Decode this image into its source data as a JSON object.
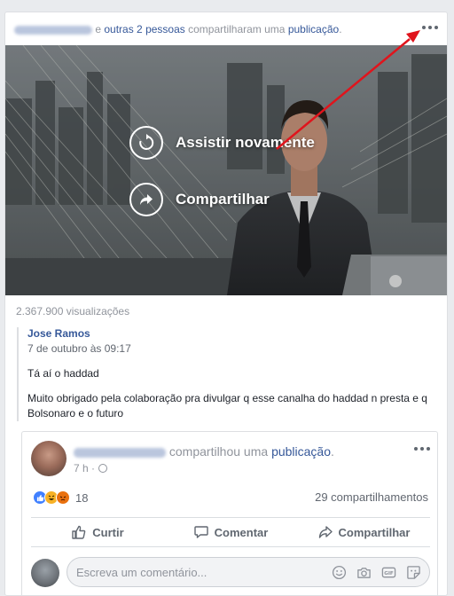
{
  "header": {
    "connector": "e",
    "others": "outras 2 pessoas",
    "shared_text": "compartilharam uma",
    "publication_link": "publicação",
    "period": "."
  },
  "video": {
    "replay_label": "Assistir novamente",
    "share_label": "Compartilhar"
  },
  "views": "2.367.900 visualizações",
  "quote": {
    "author": "Jose Ramos",
    "date": "7 de outubro às 09:17",
    "line1": "Tá aí o haddad",
    "line2": "Muito obrigado pela colaboração pra divulgar q esse canalha do haddad n presta e q Bolsonaro e o futuro"
  },
  "inner": {
    "shared_text": "compartilhou uma",
    "publication_link": "publicação",
    "period": ".",
    "time": "7 h ·",
    "reaction_count": "18",
    "shares": "29 compartilhamentos",
    "actions": {
      "like": "Curtir",
      "comment": "Comentar",
      "share": "Compartilhar"
    },
    "comment_placeholder": "Escreva um comentário..."
  },
  "icons": [
    "more-icon",
    "replay-icon",
    "share-icon",
    "globe-icon",
    "like-reaction-icon",
    "haha-reaction-icon",
    "angry-reaction-icon",
    "thumb-up-icon",
    "comment-icon",
    "share-arrow-icon",
    "emoji-icon",
    "camera-icon",
    "gif-icon",
    "sticker-icon"
  ],
  "colors": {
    "link": "#365899",
    "annotation_arrow": "#e0141c",
    "like_blue": "#4080ff"
  }
}
